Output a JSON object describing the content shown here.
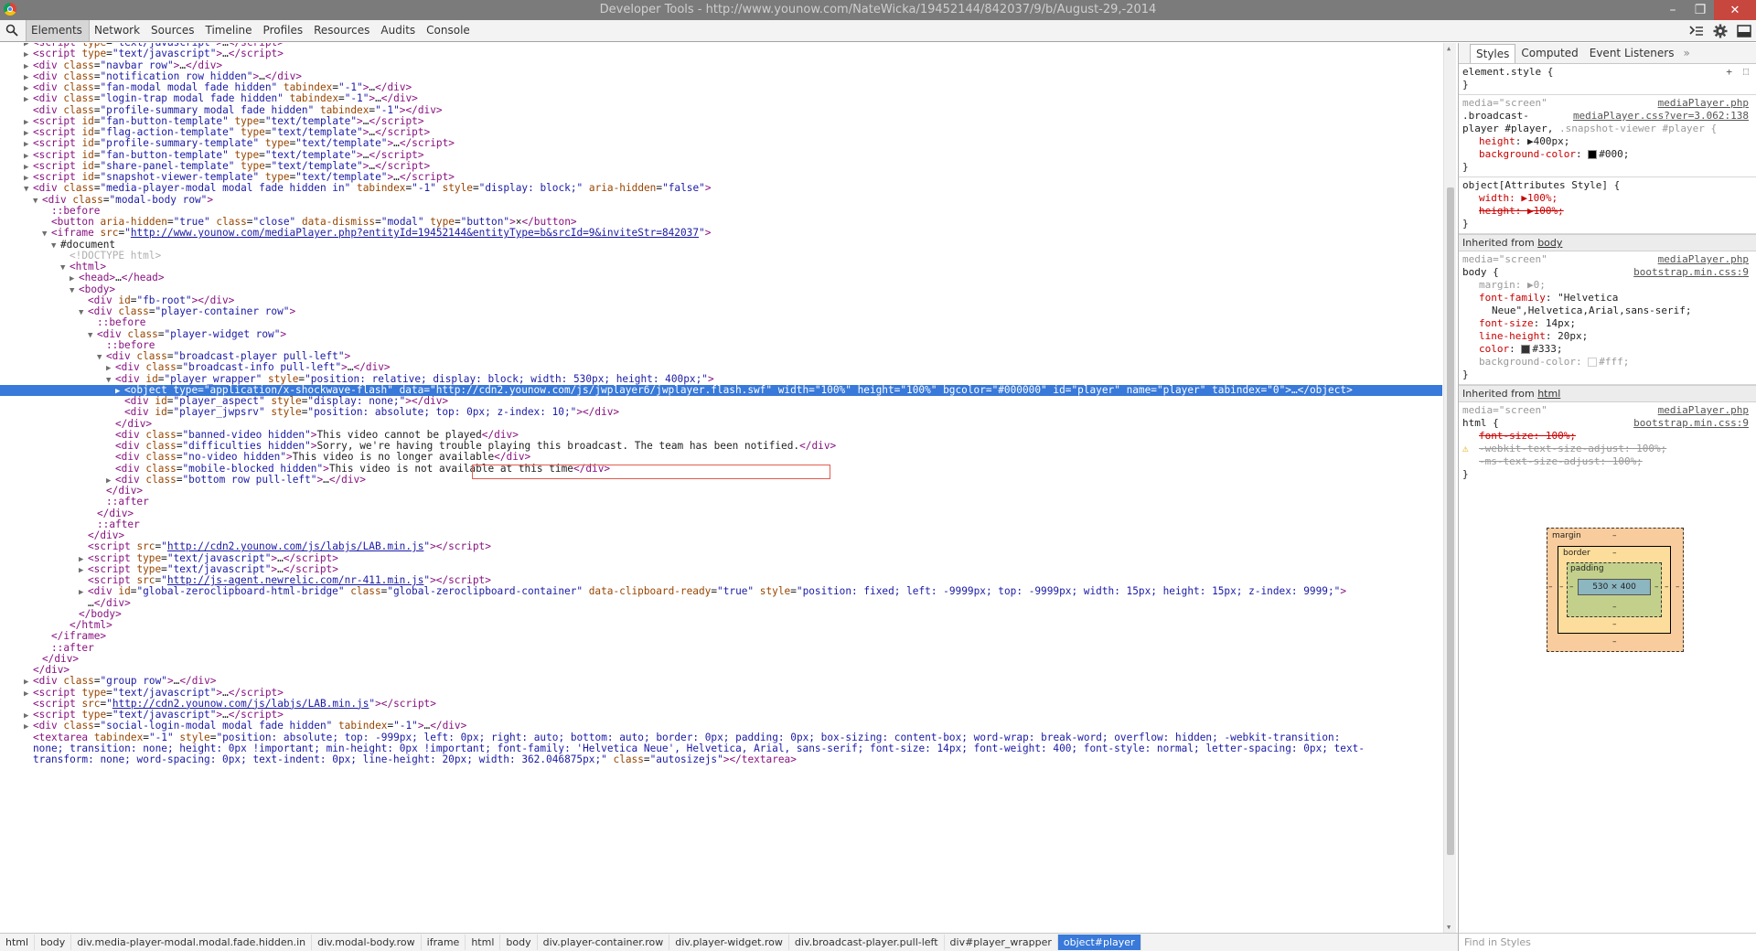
{
  "window": {
    "title": "Developer Tools - http://www.younow.com/NateWicka/19452144/842037/9/b/August-29,-2014",
    "controls": [
      "–",
      "❐",
      "✕"
    ]
  },
  "toolbar": {
    "tabs": [
      "Elements",
      "Network",
      "Sources",
      "Timeline",
      "Profiles",
      "Resources",
      "Audits",
      "Console"
    ],
    "active_tab": "Elements"
  },
  "dom_tree": [
    {
      "i": 3,
      "a": "▶",
      "h": "<span class='tag'>&lt;script</span> <span class='attr'>type</span>=<span class='val'>\"text/javascript\"</span><span class='tag'>&gt;</span>…<span class='tag'>&lt;/script&gt;</span>"
    },
    {
      "i": 3,
      "a": "▶",
      "h": "<span class='tag'>&lt;script</span> <span class='attr'>type</span>=<span class='val'>\"text/javascript\"</span><span class='tag'>&gt;</span>…<span class='tag'>&lt;/script&gt;</span>"
    },
    {
      "i": 3,
      "a": "▶",
      "h": "<span class='tag'>&lt;div</span> <span class='attr'>class</span>=<span class='val'>\"navbar row\"</span><span class='tag'>&gt;</span>…<span class='tag'>&lt;/div&gt;</span>"
    },
    {
      "i": 3,
      "a": "▶",
      "h": "<span class='tag'>&lt;div</span> <span class='attr'>class</span>=<span class='val'>\"notification row hidden\"</span><span class='tag'>&gt;</span>…<span class='tag'>&lt;/div&gt;</span>"
    },
    {
      "i": 3,
      "a": "▶",
      "h": "<span class='tag'>&lt;div</span> <span class='attr'>class</span>=<span class='val'>\"fan-modal modal fade hidden\"</span> <span class='attr'>tabindex</span>=<span class='val'>\"-1\"</span><span class='tag'>&gt;</span>…<span class='tag'>&lt;/div&gt;</span>"
    },
    {
      "i": 3,
      "a": "▶",
      "h": "<span class='tag'>&lt;div</span> <span class='attr'>class</span>=<span class='val'>\"login-trap modal fade hidden\"</span> <span class='attr'>tabindex</span>=<span class='val'>\"-1\"</span><span class='tag'>&gt;</span>…<span class='tag'>&lt;/div&gt;</span>"
    },
    {
      "i": 3,
      "a": "",
      "h": "<span class='tag'>&lt;div</span> <span class='attr'>class</span>=<span class='val'>\"profile-summary modal fade hidden\"</span> <span class='attr'>tabindex</span>=<span class='val'>\"-1\"</span><span class='tag'>&gt;&lt;/div&gt;</span>"
    },
    {
      "i": 3,
      "a": "▶",
      "h": "<span class='tag'>&lt;script</span> <span class='attr'>id</span>=<span class='val'>\"fan-button-template\"</span> <span class='attr'>type</span>=<span class='val'>\"text/template\"</span><span class='tag'>&gt;</span>…<span class='tag'>&lt;/script&gt;</span>"
    },
    {
      "i": 3,
      "a": "▶",
      "h": "<span class='tag'>&lt;script</span> <span class='attr'>id</span>=<span class='val'>\"flag-action-template\"</span> <span class='attr'>type</span>=<span class='val'>\"text/template\"</span><span class='tag'>&gt;</span>…<span class='tag'>&lt;/script&gt;</span>"
    },
    {
      "i": 3,
      "a": "▶",
      "h": "<span class='tag'>&lt;script</span> <span class='attr'>id</span>=<span class='val'>\"profile-summary-template\"</span> <span class='attr'>type</span>=<span class='val'>\"text/template\"</span><span class='tag'>&gt;</span>…<span class='tag'>&lt;/script&gt;</span>"
    },
    {
      "i": 3,
      "a": "▶",
      "h": "<span class='tag'>&lt;script</span> <span class='attr'>id</span>=<span class='val'>\"fan-button-template\"</span> <span class='attr'>type</span>=<span class='val'>\"text/template\"</span><span class='tag'>&gt;</span>…<span class='tag'>&lt;/script&gt;</span>"
    },
    {
      "i": 3,
      "a": "▶",
      "h": "<span class='tag'>&lt;script</span> <span class='attr'>id</span>=<span class='val'>\"share-panel-template\"</span> <span class='attr'>type</span>=<span class='val'>\"text/template\"</span><span class='tag'>&gt;</span>…<span class='tag'>&lt;/script&gt;</span>"
    },
    {
      "i": 3,
      "a": "▶",
      "h": "<span class='tag'>&lt;script</span> <span class='attr'>id</span>=<span class='val'>\"snapshot-viewer-template\"</span> <span class='attr'>type</span>=<span class='val'>\"text/template\"</span><span class='tag'>&gt;</span>…<span class='tag'>&lt;/script&gt;</span>"
    },
    {
      "i": 3,
      "a": "▼",
      "h": "<span class='tag'>&lt;div</span> <span class='attr'>class</span>=<span class='val'>\"media-player-modal modal fade hidden in\"</span> <span class='attr'>tabindex</span>=<span class='val'>\"-1\"</span> <span class='attr'>style</span>=<span class='val'>\"display: block;\"</span> <span class='attr'>aria-hidden</span>=<span class='val'>\"false\"</span><span class='tag'>&gt;</span>"
    },
    {
      "i": 4,
      "a": "▼",
      "h": "<span class='tag'>&lt;div</span> <span class='attr'>class</span>=<span class='val'>\"modal-body row\"</span><span class='tag'>&gt;</span>"
    },
    {
      "i": 5,
      "a": "",
      "h": "<span class='pseudo'>::before</span>"
    },
    {
      "i": 5,
      "a": "",
      "h": "<span class='tag'>&lt;button</span> <span class='attr'>aria-hidden</span>=<span class='val'>\"true\"</span> <span class='attr'>class</span>=<span class='val'>\"close\"</span> <span class='attr'>data-dismiss</span>=<span class='val'>\"modal\"</span> <span class='attr'>type</span>=<span class='val'>\"button\"</span><span class='tag'>&gt;</span>×<span class='tag'>&lt;/button&gt;</span>"
    },
    {
      "i": 5,
      "a": "▼",
      "h": "<span class='tag'>&lt;iframe</span> <span class='attr'>src</span>=<span class='val'>\"</span><span class='link'>http://www.younow.com/mediaPlayer.php?entityId=19452144&amp;entityType=b&amp;srcId=9&amp;inviteStr=842037</span><span class='val'>\"</span><span class='tag'>&gt;</span>"
    },
    {
      "i": 6,
      "a": "▼",
      "h": "<span class='plain'>#document</span>"
    },
    {
      "i": 7,
      "a": "",
      "h": "<span class='comment'>&lt;!DOCTYPE html&gt;</span>"
    },
    {
      "i": 7,
      "a": "▼",
      "h": "<span class='tag'>&lt;html&gt;</span>"
    },
    {
      "i": 8,
      "a": "▶",
      "h": "<span class='tag'>&lt;head&gt;</span>…<span class='tag'>&lt;/head&gt;</span>"
    },
    {
      "i": 8,
      "a": "▼",
      "h": "<span class='tag'>&lt;body&gt;</span>"
    },
    {
      "i": 9,
      "a": "",
      "h": "<span class='tag'>&lt;div</span> <span class='attr'>id</span>=<span class='val'>\"fb-root\"</span><span class='tag'>&gt;&lt;/div&gt;</span>"
    },
    {
      "i": 9,
      "a": "▼",
      "h": "<span class='tag'>&lt;div</span> <span class='attr'>class</span>=<span class='val'>\"player-container row\"</span><span class='tag'>&gt;</span>"
    },
    {
      "i": 10,
      "a": "",
      "h": "<span class='pseudo'>::before</span>"
    },
    {
      "i": 10,
      "a": "▼",
      "h": "<span class='tag'>&lt;div</span> <span class='attr'>class</span>=<span class='val'>\"player-widget row\"</span><span class='tag'>&gt;</span>"
    },
    {
      "i": 11,
      "a": "",
      "h": "<span class='pseudo'>::before</span>"
    },
    {
      "i": 11,
      "a": "▼",
      "h": "<span class='tag'>&lt;div</span> <span class='attr'>class</span>=<span class='val'>\"broadcast-player pull-left\"</span><span class='tag'>&gt;</span>"
    },
    {
      "i": 12,
      "a": "▶",
      "h": "<span class='tag'>&lt;div</span> <span class='attr'>class</span>=<span class='val'>\"broadcast-info pull-left\"</span><span class='tag'>&gt;</span>…<span class='tag'>&lt;/div&gt;</span>"
    },
    {
      "i": 12,
      "a": "▼",
      "h": "<span class='tag'>&lt;div</span> <span class='attr'>id</span>=<span class='val'>\"player_wrapper\"</span> <span class='attr'>style</span>=<span class='val'>\"position: relative; <span class='dotted-under'>display: block; width: 530px; height: 400px;</span>\"</span><span class='tag'>&gt;</span>"
    },
    {
      "i": 13,
      "a": "▶",
      "sel": true,
      "h": "<span class='tag'>&lt;object</span> <span class='attr'>type</span>=<span class='val'>\"application/x-shockwave-flash\"</span> <span class='attr'>data</span>=<span class='val'>\"http://cdn2.younow.com/js/jwplayer6/jwplayer.flash.swf\"</span> <span class='attr'>width</span>=<span class='val'>\"100%\"</span> <span class='attr'>height</span>=<span class='val'>\"100%\"</span> <span class='attr'>bgcolor</span>=<span class='val'>\"#000000\"</span> <span class='attr'>id</span>=<span class='val'>\"player\"</span> <span class='attr'>name</span>=<span class='val'>\"player\"</span> <span class='attr'>tabindex</span>=<span class='val'>\"0\"</span><span class='tag'>&gt;</span>…<span class='tag'>&lt;/object&gt;</span>"
    },
    {
      "i": 13,
      "a": "",
      "h": "<span class='tag'>&lt;div</span> <span class='attr'>id</span>=<span class='val'>\"player_aspect\"</span> <span class='attr'>style</span>=<span class='val'>\"display: none;\"</span><span class='tag'>&gt;&lt;/div&gt;</span>"
    },
    {
      "i": 13,
      "a": "",
      "h": "<span class='tag'>&lt;div</span> <span class='attr'>id</span>=<span class='val'>\"player_jwpsrv\"</span> <span class='attr'>style</span>=<span class='val'>\"position: absolute; top: 0px; z-index: 10;\"</span><span class='tag'>&gt;&lt;/div&gt;</span>"
    },
    {
      "i": 12,
      "a": "",
      "h": "<span class='tag'>&lt;/div&gt;</span>"
    },
    {
      "i": 12,
      "a": "",
      "h": "<span class='tag'>&lt;div</span> <span class='attr'>class</span>=<span class='val'>\"banned-video hidden\"</span><span class='tag'>&gt;</span>This video cannot be played<span class='tag'>&lt;/div&gt;</span>"
    },
    {
      "i": 12,
      "a": "",
      "h": "<span class='tag'>&lt;div</span> <span class='attr'>class</span>=<span class='val'>\"difficulties hidden\"</span><span class='tag'>&gt;</span>Sorry, we're having trouble playing this broadcast. The team has been notified.<span class='tag'>&lt;/div&gt;</span>"
    },
    {
      "i": 12,
      "a": "",
      "h": "<span class='tag'>&lt;div</span> <span class='attr'>class</span>=<span class='val'>\"no-video hidden\"</span><span class='tag'>&gt;</span>This video is no longer available<span class='tag'>&lt;/div&gt;</span>"
    },
    {
      "i": 12,
      "a": "",
      "h": "<span class='tag'>&lt;div</span> <span class='attr'>class</span>=<span class='val'>\"mobile-blocked hidden\"</span><span class='tag'>&gt;</span>This video is not available at this time<span class='tag'>&lt;/div&gt;</span>"
    },
    {
      "i": 12,
      "a": "▶",
      "h": "<span class='tag'>&lt;div</span> <span class='attr'>class</span>=<span class='val'>\"bottom row pull-left\"</span><span class='tag'>&gt;</span>…<span class='tag'>&lt;/div&gt;</span>"
    },
    {
      "i": 11,
      "a": "",
      "h": "<span class='tag'>&lt;/div&gt;</span>"
    },
    {
      "i": 11,
      "a": "",
      "h": "<span class='pseudo'>::after</span>"
    },
    {
      "i": 10,
      "a": "",
      "h": "<span class='tag'>&lt;/div&gt;</span>"
    },
    {
      "i": 10,
      "a": "",
      "h": "<span class='pseudo'>::after</span>"
    },
    {
      "i": 9,
      "a": "",
      "h": "<span class='tag'>&lt;/div&gt;</span>"
    },
    {
      "i": 9,
      "a": "",
      "h": "<span class='tag'>&lt;script</span> <span class='attr'>src</span>=<span class='val'>\"</span><span class='link'>http://cdn2.younow.com/js/labjs/LAB.min.js</span><span class='val'>\"</span><span class='tag'>&gt;&lt;/script&gt;</span>"
    },
    {
      "i": 9,
      "a": "▶",
      "h": "<span class='tag'>&lt;script</span> <span class='attr'>type</span>=<span class='val'>\"text/javascript\"</span><span class='tag'>&gt;</span>…<span class='tag'>&lt;/script&gt;</span>"
    },
    {
      "i": 9,
      "a": "▶",
      "h": "<span class='tag'>&lt;script</span> <span class='attr'>type</span>=<span class='val'>\"text/javascript\"</span><span class='tag'>&gt;</span>…<span class='tag'>&lt;/script&gt;</span>"
    },
    {
      "i": 9,
      "a": "",
      "h": "<span class='tag'>&lt;script</span> <span class='attr'>src</span>=<span class='val'>\"</span><span class='link'>http://js-agent.newrelic.com/nr-411.min.js</span><span class='val'>\"</span><span class='tag'>&gt;&lt;/script&gt;</span>"
    },
    {
      "i": 9,
      "a": "▶",
      "h": "<span class='tag'>&lt;div</span> <span class='attr'>id</span>=<span class='val'>\"global-zeroclipboard-html-bridge\"</span> <span class='attr'>class</span>=<span class='val'>\"global-zeroclipboard-container\"</span> <span class='attr'>data-clipboard-ready</span>=<span class='val'>\"true\"</span> <span class='attr'>style</span>=<span class='val'>\"position: fixed; left: -9999px; top: -9999px; width: 15px; height: 15px; z-index: 9999;\"</span><span class='tag'>&gt;</span>"
    },
    {
      "i": 9,
      "a": "",
      "h": "…<span class='tag'>&lt;/div&gt;</span>"
    },
    {
      "i": 8,
      "a": "",
      "h": "<span class='tag'>&lt;/body&gt;</span>"
    },
    {
      "i": 7,
      "a": "",
      "h": "<span class='tag'>&lt;/html&gt;</span>"
    },
    {
      "i": 5,
      "a": "",
      "h": "<span class='tag'>&lt;/iframe&gt;</span>"
    },
    {
      "i": 5,
      "a": "",
      "h": "<span class='pseudo'>::after</span>"
    },
    {
      "i": 4,
      "a": "",
      "h": "<span class='tag'>&lt;/div&gt;</span>"
    },
    {
      "i": 3,
      "a": "",
      "h": "<span class='tag'>&lt;/div&gt;</span>"
    },
    {
      "i": 3,
      "a": "▶",
      "h": "<span class='tag'>&lt;div</span> <span class='attr'>class</span>=<span class='val'>\"group row\"</span><span class='tag'>&gt;</span>…<span class='tag'>&lt;/div&gt;</span>"
    },
    {
      "i": 3,
      "a": "▶",
      "h": "<span class='tag'>&lt;script</span> <span class='attr'>type</span>=<span class='val'>\"text/javascript\"</span><span class='tag'>&gt;</span>…<span class='tag'>&lt;/script&gt;</span>"
    },
    {
      "i": 3,
      "a": "",
      "h": "<span class='tag'>&lt;script</span> <span class='attr'>src</span>=<span class='val'>\"</span><span class='link'>http://cdn2.younow.com/js/labjs/LAB.min.js</span><span class='val'>\"</span><span class='tag'>&gt;&lt;/script&gt;</span>"
    },
    {
      "i": 3,
      "a": "▶",
      "h": "<span class='tag'>&lt;script</span> <span class='attr'>type</span>=<span class='val'>\"text/javascript\"</span><span class='tag'>&gt;</span>…<span class='tag'>&lt;/script&gt;</span>"
    },
    {
      "i": 3,
      "a": "▶",
      "h": "<span class='tag'>&lt;div</span> <span class='attr'>class</span>=<span class='val'>\"social-login-modal modal fade hidden\"</span> <span class='attr'>tabindex</span>=<span class='val'>\"-1\"</span><span class='tag'>&gt;</span>…<span class='tag'>&lt;/div&gt;</span>"
    },
    {
      "i": 3,
      "a": "",
      "h": "<span class='tag'>&lt;textarea</span> <span class='attr'>tabindex</span>=<span class='val'>\"-1\"</span> <span class='attr'>style</span>=<span class='val'>\"position: absolute; top: -999px; left: 0px; right: auto; bottom: auto; border: 0px; padding: 0px; box-sizing: content-box; word-wrap: break-word; overflow: hidden; -webkit-transition:</span>"
    },
    {
      "i": 3,
      "a": "",
      "h": "<span class='val'>none; transition: none; height: 0px !important; min-height: 0px !important; font-family: 'Helvetica Neue', Helvetica, Arial, sans-serif; font-size: 14px; font-weight: 400; font-style: normal; letter-spacing: 0px; text-</span>"
    },
    {
      "i": 3,
      "a": "",
      "h": "<span class='val'>transform: none; word-spacing: 0px; text-indent: 0px; line-height: 20px; width: 362.046875px;\"</span> <span class='attr'>class</span>=<span class='val'>\"autosizejs\"</span><span class='tag'>&gt;&lt;/textarea&gt;</span>"
    }
  ],
  "sidebar": {
    "tabs": [
      "Styles",
      "Computed",
      "Event Listeners"
    ],
    "more": "»",
    "element_style": "element.style {",
    "close_brace": "}",
    "rule1": {
      "media": "media=\"screen\"",
      "src1": "mediaPlayer.php",
      "selector_a": ".broadcast-",
      "src2": "mediaPlayer.css?ver=3.062:138",
      "selector_b": "player #player,",
      "selector_c": ".snapshot-viewer #player {",
      "p1_name": "height",
      "p1_val": "400px;",
      "p2_name": "background-color",
      "p2_val": "#000;"
    },
    "rule2": {
      "selector": "object[Attributes Style] {",
      "p1": "width: ▶100%;",
      "p2": "height: ▶100%;"
    },
    "inherited_body_label": "Inherited from",
    "inherited_body_el": "body",
    "rule3": {
      "media": "media=\"screen\"",
      "src1": "mediaPlayer.php",
      "selector": "body {",
      "src2": "bootstrap.min.css:9",
      "margin": "margin: ▶0;",
      "ff_name": "font-family",
      "ff_val1": "\"Helvetica",
      "ff_val2": "Neue\",Helvetica,Arial,sans-serif;",
      "fs_name": "font-size",
      "fs_val": "14px;",
      "lh_name": "line-height",
      "lh_val": "20px;",
      "color_name": "color",
      "color_val": "#333;",
      "bg_name": "background-color",
      "bg_val": "#fff;"
    },
    "inherited_html_label": "Inherited from",
    "inherited_html_el": "html",
    "rule4": {
      "media": "media=\"screen\"",
      "src1": "mediaPlayer.php",
      "selector": "html {",
      "src2": "bootstrap.min.css:9",
      "p1": "font-size: 100%;",
      "p2": "-webkit-text-size-adjust: 100%;",
      "p3": "-ms-text-size-adjust: 100%;"
    },
    "box_model": {
      "margin_label": "margin",
      "border_label": "border",
      "padding_label": "padding",
      "dash": "–",
      "content": "530 × 400"
    },
    "find_placeholder": "Find in Styles"
  },
  "breadcrumbs": [
    "html",
    "body",
    "div.media-player-modal.modal.fade.hidden.in",
    "div.modal-body.row",
    "iframe",
    "html",
    "body",
    "div.player-container.row",
    "div.player-widget.row",
    "div.broadcast-player.pull-left",
    "div#player_wrapper",
    "object#player"
  ],
  "colors": {
    "selection": "#3879d9",
    "tag": "#881280",
    "attr": "#994500",
    "value": "#1a1aa6"
  }
}
